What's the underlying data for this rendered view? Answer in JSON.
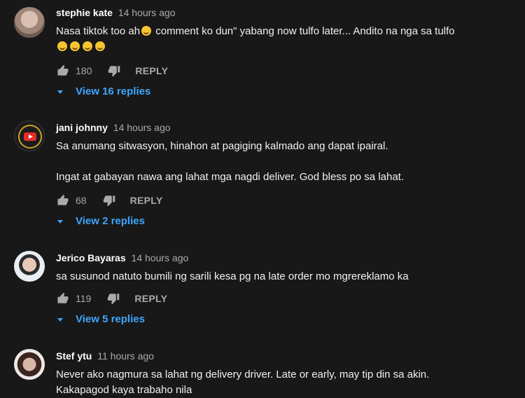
{
  "comments": [
    {
      "author": "stephie kate",
      "time": "14 hours ago",
      "text_line1": "Nasa tiktok too ah",
      "text_line1b": " comment ko dun\" yabang now tulfo later... Andito na nga sa tulfo",
      "likes": "180",
      "reply_label": "REPLY",
      "view_replies": "View 16 replies"
    },
    {
      "author": "jani johnny",
      "time": "14 hours ago",
      "text_p1": "Sa anumang sitwasyon, hinahon at pagiging kalmado ang dapat ipairal.",
      "text_p2": "Ingat at gabayan nawa ang lahat mga nagdi deliver. God bless po sa lahat.",
      "likes": "68",
      "reply_label": "REPLY",
      "view_replies": "View 2 replies"
    },
    {
      "author": "Jerico Bayaras",
      "time": "14 hours ago",
      "text": "sa susunod natuto bumili ng sarili kesa pg na late order mo mgrereklamo ka",
      "likes": "119",
      "reply_label": "REPLY",
      "view_replies": "View 5 replies"
    },
    {
      "author": "Stef ytu",
      "time": "11 hours ago",
      "text_l1": "Never ako nagmura sa lahat ng delivery driver. Late or early, may tip din sa akin.",
      "text_l2": "Kakapagod kaya trabaho nila"
    }
  ],
  "icons": {
    "like": "thumb-up-icon",
    "dislike": "thumb-down-icon",
    "caret": "caret-down-icon"
  },
  "colors": {
    "background": "#181818",
    "link": "#3ea6ff",
    "muted": "#aaaaaa",
    "text": "#f1f1f1"
  }
}
